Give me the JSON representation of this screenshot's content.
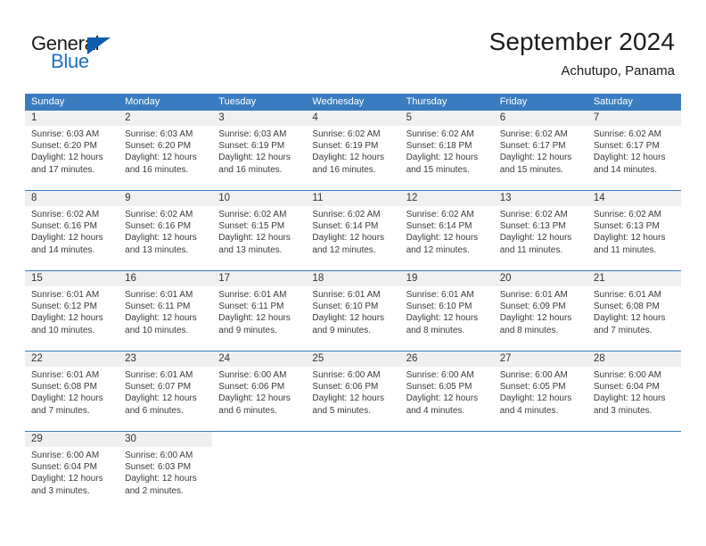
{
  "brand": {
    "word1": "General",
    "word2": "Blue",
    "triangle_color": "#0b5fae",
    "blue_color": "#1f6fc4"
  },
  "header": {
    "title": "September 2024",
    "subtitle": "Achutupo, Panama"
  },
  "theme": {
    "header_bar": "#3a7cc0",
    "daynum_band": "#f0f0f0",
    "text": "#333333"
  },
  "weekdays": [
    "Sunday",
    "Monday",
    "Tuesday",
    "Wednesday",
    "Thursday",
    "Friday",
    "Saturday"
  ],
  "weeks": [
    [
      {
        "day": "1",
        "sunrise": "Sunrise: 6:03 AM",
        "sunset": "Sunset: 6:20 PM",
        "daylight1": "Daylight: 12 hours",
        "daylight2": "and 17 minutes."
      },
      {
        "day": "2",
        "sunrise": "Sunrise: 6:03 AM",
        "sunset": "Sunset: 6:20 PM",
        "daylight1": "Daylight: 12 hours",
        "daylight2": "and 16 minutes."
      },
      {
        "day": "3",
        "sunrise": "Sunrise: 6:03 AM",
        "sunset": "Sunset: 6:19 PM",
        "daylight1": "Daylight: 12 hours",
        "daylight2": "and 16 minutes."
      },
      {
        "day": "4",
        "sunrise": "Sunrise: 6:02 AM",
        "sunset": "Sunset: 6:19 PM",
        "daylight1": "Daylight: 12 hours",
        "daylight2": "and 16 minutes."
      },
      {
        "day": "5",
        "sunrise": "Sunrise: 6:02 AM",
        "sunset": "Sunset: 6:18 PM",
        "daylight1": "Daylight: 12 hours",
        "daylight2": "and 15 minutes."
      },
      {
        "day": "6",
        "sunrise": "Sunrise: 6:02 AM",
        "sunset": "Sunset: 6:17 PM",
        "daylight1": "Daylight: 12 hours",
        "daylight2": "and 15 minutes."
      },
      {
        "day": "7",
        "sunrise": "Sunrise: 6:02 AM",
        "sunset": "Sunset: 6:17 PM",
        "daylight1": "Daylight: 12 hours",
        "daylight2": "and 14 minutes."
      }
    ],
    [
      {
        "day": "8",
        "sunrise": "Sunrise: 6:02 AM",
        "sunset": "Sunset: 6:16 PM",
        "daylight1": "Daylight: 12 hours",
        "daylight2": "and 14 minutes."
      },
      {
        "day": "9",
        "sunrise": "Sunrise: 6:02 AM",
        "sunset": "Sunset: 6:16 PM",
        "daylight1": "Daylight: 12 hours",
        "daylight2": "and 13 minutes."
      },
      {
        "day": "10",
        "sunrise": "Sunrise: 6:02 AM",
        "sunset": "Sunset: 6:15 PM",
        "daylight1": "Daylight: 12 hours",
        "daylight2": "and 13 minutes."
      },
      {
        "day": "11",
        "sunrise": "Sunrise: 6:02 AM",
        "sunset": "Sunset: 6:14 PM",
        "daylight1": "Daylight: 12 hours",
        "daylight2": "and 12 minutes."
      },
      {
        "day": "12",
        "sunrise": "Sunrise: 6:02 AM",
        "sunset": "Sunset: 6:14 PM",
        "daylight1": "Daylight: 12 hours",
        "daylight2": "and 12 minutes."
      },
      {
        "day": "13",
        "sunrise": "Sunrise: 6:02 AM",
        "sunset": "Sunset: 6:13 PM",
        "daylight1": "Daylight: 12 hours",
        "daylight2": "and 11 minutes."
      },
      {
        "day": "14",
        "sunrise": "Sunrise: 6:02 AM",
        "sunset": "Sunset: 6:13 PM",
        "daylight1": "Daylight: 12 hours",
        "daylight2": "and 11 minutes."
      }
    ],
    [
      {
        "day": "15",
        "sunrise": "Sunrise: 6:01 AM",
        "sunset": "Sunset: 6:12 PM",
        "daylight1": "Daylight: 12 hours",
        "daylight2": "and 10 minutes."
      },
      {
        "day": "16",
        "sunrise": "Sunrise: 6:01 AM",
        "sunset": "Sunset: 6:11 PM",
        "daylight1": "Daylight: 12 hours",
        "daylight2": "and 10 minutes."
      },
      {
        "day": "17",
        "sunrise": "Sunrise: 6:01 AM",
        "sunset": "Sunset: 6:11 PM",
        "daylight1": "Daylight: 12 hours",
        "daylight2": "and 9 minutes."
      },
      {
        "day": "18",
        "sunrise": "Sunrise: 6:01 AM",
        "sunset": "Sunset: 6:10 PM",
        "daylight1": "Daylight: 12 hours",
        "daylight2": "and 9 minutes."
      },
      {
        "day": "19",
        "sunrise": "Sunrise: 6:01 AM",
        "sunset": "Sunset: 6:10 PM",
        "daylight1": "Daylight: 12 hours",
        "daylight2": "and 8 minutes."
      },
      {
        "day": "20",
        "sunrise": "Sunrise: 6:01 AM",
        "sunset": "Sunset: 6:09 PM",
        "daylight1": "Daylight: 12 hours",
        "daylight2": "and 8 minutes."
      },
      {
        "day": "21",
        "sunrise": "Sunrise: 6:01 AM",
        "sunset": "Sunset: 6:08 PM",
        "daylight1": "Daylight: 12 hours",
        "daylight2": "and 7 minutes."
      }
    ],
    [
      {
        "day": "22",
        "sunrise": "Sunrise: 6:01 AM",
        "sunset": "Sunset: 6:08 PM",
        "daylight1": "Daylight: 12 hours",
        "daylight2": "and 7 minutes."
      },
      {
        "day": "23",
        "sunrise": "Sunrise: 6:01 AM",
        "sunset": "Sunset: 6:07 PM",
        "daylight1": "Daylight: 12 hours",
        "daylight2": "and 6 minutes."
      },
      {
        "day": "24",
        "sunrise": "Sunrise: 6:00 AM",
        "sunset": "Sunset: 6:06 PM",
        "daylight1": "Daylight: 12 hours",
        "daylight2": "and 6 minutes."
      },
      {
        "day": "25",
        "sunrise": "Sunrise: 6:00 AM",
        "sunset": "Sunset: 6:06 PM",
        "daylight1": "Daylight: 12 hours",
        "daylight2": "and 5 minutes."
      },
      {
        "day": "26",
        "sunrise": "Sunrise: 6:00 AM",
        "sunset": "Sunset: 6:05 PM",
        "daylight1": "Daylight: 12 hours",
        "daylight2": "and 4 minutes."
      },
      {
        "day": "27",
        "sunrise": "Sunrise: 6:00 AM",
        "sunset": "Sunset: 6:05 PM",
        "daylight1": "Daylight: 12 hours",
        "daylight2": "and 4 minutes."
      },
      {
        "day": "28",
        "sunrise": "Sunrise: 6:00 AM",
        "sunset": "Sunset: 6:04 PM",
        "daylight1": "Daylight: 12 hours",
        "daylight2": "and 3 minutes."
      }
    ],
    [
      {
        "day": "29",
        "sunrise": "Sunrise: 6:00 AM",
        "sunset": "Sunset: 6:04 PM",
        "daylight1": "Daylight: 12 hours",
        "daylight2": "and 3 minutes."
      },
      {
        "day": "30",
        "sunrise": "Sunrise: 6:00 AM",
        "sunset": "Sunset: 6:03 PM",
        "daylight1": "Daylight: 12 hours",
        "daylight2": "and 2 minutes."
      },
      {
        "day": "",
        "sunrise": "",
        "sunset": "",
        "daylight1": "",
        "daylight2": ""
      },
      {
        "day": "",
        "sunrise": "",
        "sunset": "",
        "daylight1": "",
        "daylight2": ""
      },
      {
        "day": "",
        "sunrise": "",
        "sunset": "",
        "daylight1": "",
        "daylight2": ""
      },
      {
        "day": "",
        "sunrise": "",
        "sunset": "",
        "daylight1": "",
        "daylight2": ""
      },
      {
        "day": "",
        "sunrise": "",
        "sunset": "",
        "daylight1": "",
        "daylight2": ""
      }
    ]
  ]
}
